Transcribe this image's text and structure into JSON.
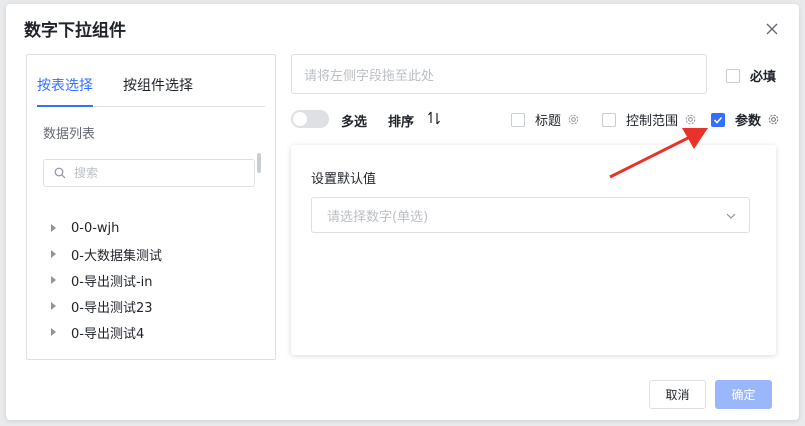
{
  "dialog": {
    "title": "数字下拉组件",
    "close_icon": "close-icon"
  },
  "left_panel": {
    "tabs": [
      {
        "label": "按表选择",
        "active": true
      },
      {
        "label": "按组件选择",
        "active": false
      }
    ],
    "section_label": "数据列表",
    "search_placeholder": "搜索",
    "tree_items": [
      {
        "label": "0-0-wjh"
      },
      {
        "label": "0-大数据集测试"
      },
      {
        "label": "0-导出测试-in"
      },
      {
        "label": "0-导出测试23"
      },
      {
        "label": "0-导出测试4"
      }
    ]
  },
  "field": {
    "placeholder": "请将左侧字段拖至此处",
    "required_label": "必填",
    "required_checked": false
  },
  "toolbar": {
    "multi_select_label": "多选",
    "multi_select_on": false,
    "sort_label": "排序",
    "title_label": "标题",
    "title_checked": false,
    "control_range_label": "控制范围",
    "control_range_checked": false,
    "param_label": "参数",
    "param_checked": true
  },
  "default_value": {
    "label": "设置默认值",
    "select_placeholder": "请选择数字(单选)"
  },
  "footer": {
    "cancel_label": "取消",
    "ok_label": "确定"
  },
  "colors": {
    "accent": "#3370ff",
    "annotation_arrow": "#e8332a"
  }
}
